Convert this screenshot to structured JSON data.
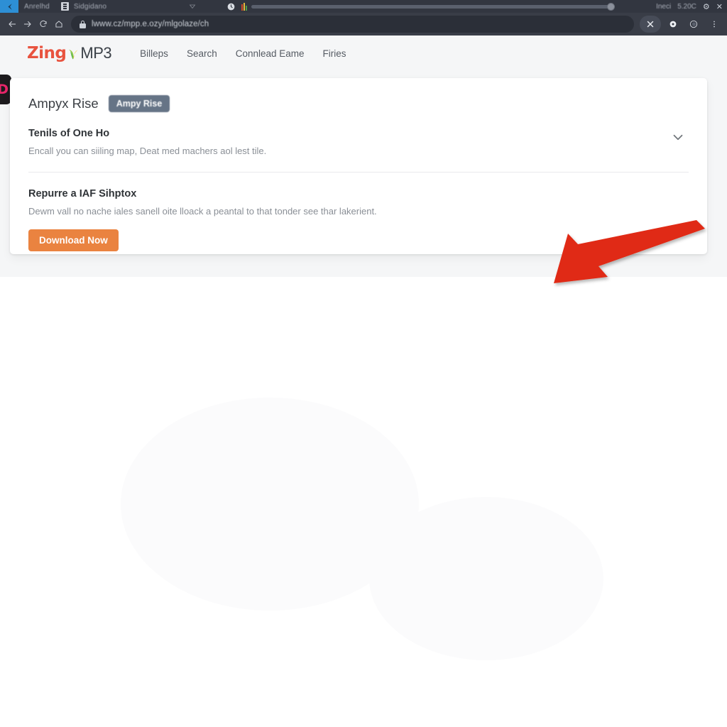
{
  "browser": {
    "tab_strip": {
      "favicon_name": "browser-favicon",
      "tab_title": "Anrelhd",
      "second_tab_title": "Sidgidano",
      "triangle_icon": "dropdown-triangle-icon",
      "clock_icon": "clock-icon",
      "status_text_left": "Ineci",
      "status_text_right": "5.20C",
      "settings_glyph": "⚙",
      "close_glyph": "✕"
    },
    "toolbar": {
      "back_label": "Back",
      "forward_label": "Forward",
      "reload_label": "Reload",
      "home_label": "Home",
      "url": "lwww.cz/mpp.e.ozy/mlgolaze/ch",
      "lock_icon": "lock-icon",
      "extensions_icon": "extensions-icon",
      "settings_icon": "gear-icon",
      "profile_icon": "profile-icon",
      "menu_icon": "more-vertical-icon"
    }
  },
  "site": {
    "logo": {
      "primary": "Zing",
      "secondary": "MP3",
      "leaf_icon": "leaf-icon"
    },
    "corner_badge_glyph": "D",
    "nav": [
      {
        "label": "Billeps",
        "name": "nav-link-billeps"
      },
      {
        "label": "Search",
        "name": "nav-link-search"
      },
      {
        "label": "Connlead Eame",
        "name": "nav-link-connlead-eame"
      },
      {
        "label": "Firies",
        "name": "nav-link-firies"
      }
    ]
  },
  "card": {
    "title": "Ampyx Rise",
    "badge": "Ampy Rise",
    "sections": [
      {
        "heading": "Tenils of One Ho",
        "description": "Encall you can siiling map, Deat med machers aol lest tile.",
        "chevron_icon": "chevron-down-icon"
      },
      {
        "heading": "Repurre a IAF Sihptox",
        "description": "Dewm vall no nache iales sanell oite lloack a peantal to that tonder see thar lakerient.",
        "button_label": "Download Now"
      }
    ]
  },
  "annotation": {
    "arrow_name": "red-pointer-arrow",
    "arrow_color": "#e02b14",
    "direction": "down-left"
  },
  "colors": {
    "accent_orange": "#ea8340",
    "badge_slate": "#667486",
    "brand_red": "#e8533f",
    "chrome_dark": "#393d47",
    "page_bg": "#f5f6f7"
  }
}
